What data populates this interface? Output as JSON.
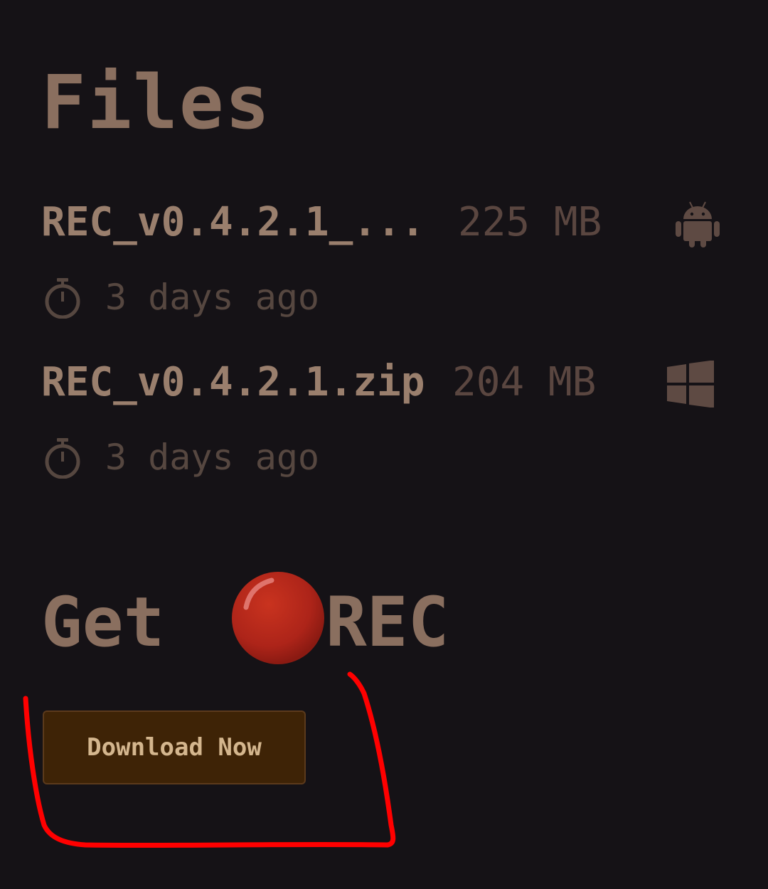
{
  "files_section": {
    "title": "Files",
    "files": [
      {
        "name": "REC_v0.4.2.1_...",
        "size": "225 MB",
        "platform_icon": "android-icon",
        "time": "3 days ago"
      },
      {
        "name": "REC_v0.4.2.1.zip",
        "size": "204 MB",
        "platform_icon": "windows-icon",
        "time": "3 days ago"
      }
    ]
  },
  "get_section": {
    "prefix": "Get",
    "app_name": "REC",
    "logo_icon": "red-record-button-icon",
    "download_label": "Download Now"
  },
  "colors": {
    "background": "#151216",
    "heading": "#8a6f5f",
    "muted": "#564740",
    "button_bg": "#3e2306",
    "button_text": "#d4b68e",
    "logo_red": "#b0281c",
    "annotation_red": "#ff0000"
  }
}
